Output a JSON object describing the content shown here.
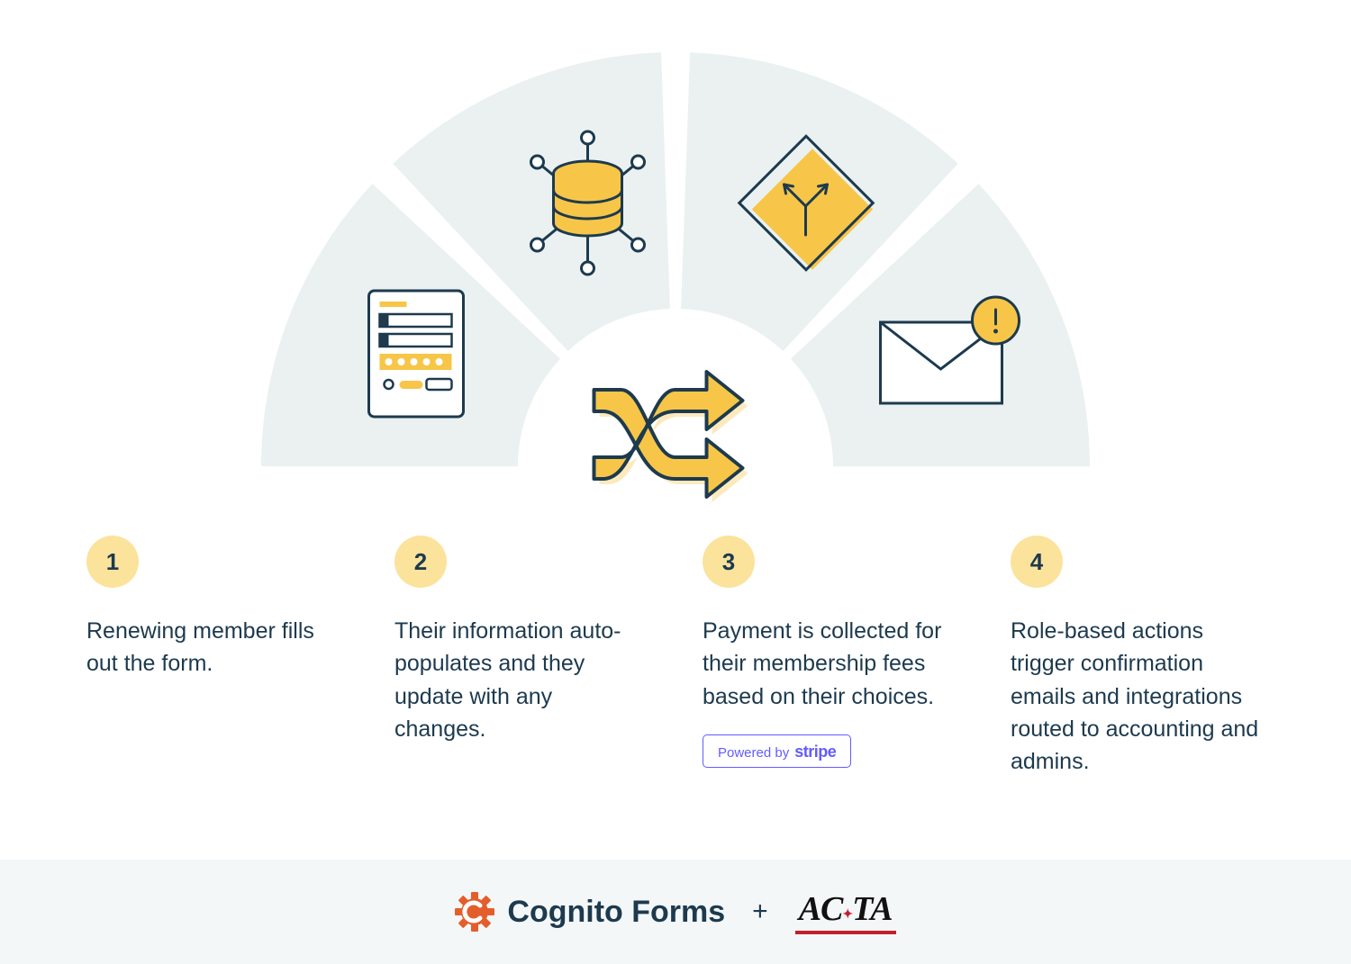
{
  "steps": [
    {
      "num": "1",
      "text": "Renewing member fills out the form."
    },
    {
      "num": "2",
      "text": "Their information auto-populates and they update with any changes."
    },
    {
      "num": "3",
      "text": "Payment is collected for their membership fees based on their choices."
    },
    {
      "num": "4",
      "text": "Role-based actions trigger confirmation emails and integrations routed to accounting and admins."
    }
  ],
  "stripe": {
    "powered": "Powered by",
    "brand": "stripe"
  },
  "footer": {
    "cognito": "Cognito Forms",
    "plus": "+",
    "acta_pre": "A",
    "acta_c": "C",
    "acta_post": "TA"
  }
}
